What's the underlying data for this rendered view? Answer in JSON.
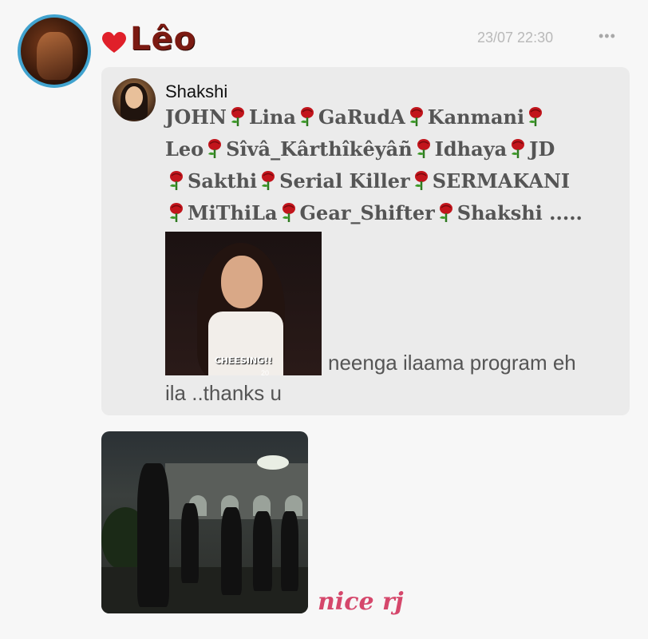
{
  "post": {
    "username": "Lêo",
    "timestamp": "23/07 22:30",
    "more_icon": "•••",
    "reply_text": "nice rj",
    "colors": {
      "username": "#7b1a12",
      "avatar_ring": "#41a3cf",
      "reply": "#d5476b",
      "heart": "#e0202a"
    }
  },
  "quoted": {
    "author": "Shakshi",
    "lines": [
      [
        "JOHN",
        "Lina",
        "GaRudA",
        "Kanmani"
      ],
      [
        "Leo",
        "Sîvâ_Kârthîkêyâñ",
        "Idhaya",
        "JD"
      ],
      [
        "Sakthi",
        "Serial Killer",
        "SERMAKANI"
      ],
      [
        "MiThiLa",
        "Gear_Shifter",
        "Shakshi ....."
      ]
    ],
    "gif_caption": "CHEESING!!",
    "gif_number": "20",
    "message_part1": "neenga ilaama program eh",
    "message_part2": "ila ..thanks u"
  },
  "icons": [
    "heart-icon",
    "rose-icon",
    "more-options-icon"
  ]
}
